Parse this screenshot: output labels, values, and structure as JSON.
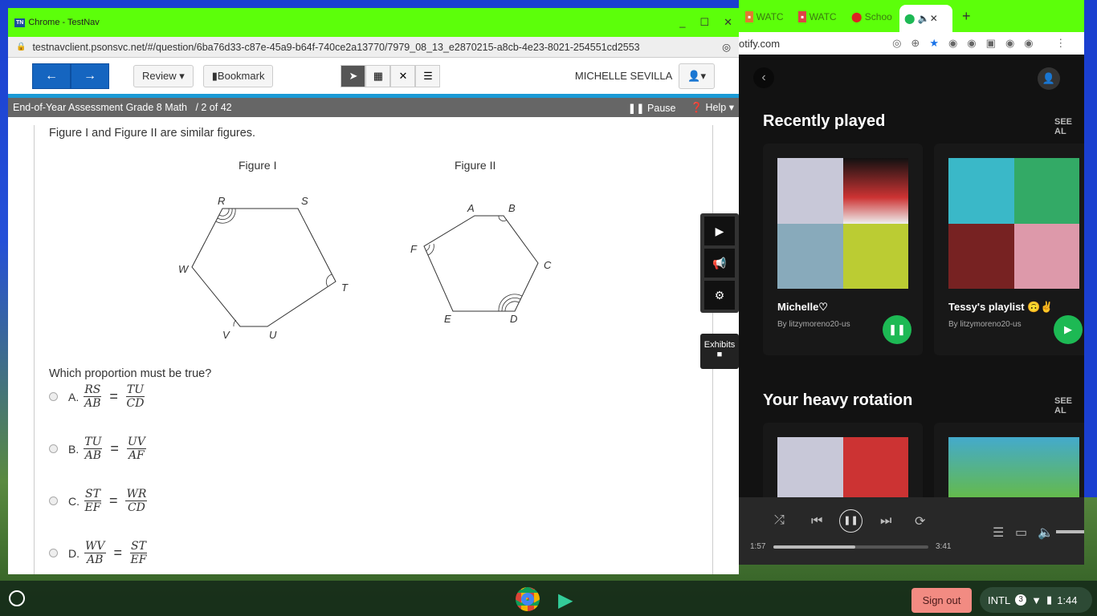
{
  "testnav": {
    "window_title": "Chrome - TestNav",
    "url": "testnavclient.psonsvc.net/#/question/6ba76d33-c87e-45a9-b64f-740ce2a13770/7979_08_13_e2870215-a8cb-4e23-8021-254551cd2553",
    "review": "Review",
    "bookmark": "Bookmark",
    "user": "MICHELLE SEVILLA",
    "test_name": "End-of-Year Assessment Grade 8 Math",
    "progress": "/  2 of 42",
    "pause": "Pause",
    "help": "Help",
    "exhibits": "Exhibits"
  },
  "question": {
    "intro": "Figure I and Figure II are similar figures.",
    "fig1_title": "Figure I",
    "fig2_title": "Figure II",
    "fig1_labels": [
      "R",
      "S",
      "T",
      "U",
      "V",
      "W"
    ],
    "fig2_labels": [
      "A",
      "B",
      "C",
      "D",
      "E",
      "F"
    ],
    "prompt": "Which proportion must be true?",
    "options": [
      {
        "letter": "A.",
        "n1": "RS",
        "d1": "AB",
        "n2": "TU",
        "d2": "CD"
      },
      {
        "letter": "B.",
        "n1": "TU",
        "d1": "AB",
        "n2": "UV",
        "d2": "AF"
      },
      {
        "letter": "C.",
        "n1": "ST",
        "d1": "EF",
        "n2": "WR",
        "d2": "CD"
      },
      {
        "letter": "D.",
        "n1": "WV",
        "d1": "AB",
        "n2": "ST",
        "d2": "EF"
      }
    ]
  },
  "spotify": {
    "tabs": [
      "WATC",
      "WATC",
      "Schoo"
    ],
    "url": "otify.com",
    "recent": "Recently played",
    "see_all": "SEE AL",
    "heavy": "Your heavy rotation",
    "cards": [
      {
        "title": "Michelle♡",
        "by": "By litzymoreno20-us"
      },
      {
        "title": "Tessy's playlist 🙃✌",
        "by": "By litzymoreno20-us"
      }
    ],
    "elapsed": "1:57",
    "duration": "3:41",
    "progress": 0.53
  },
  "shelf": {
    "sign_out": "Sign out",
    "ime": "INTL",
    "notif": "3",
    "time": "1:44"
  }
}
